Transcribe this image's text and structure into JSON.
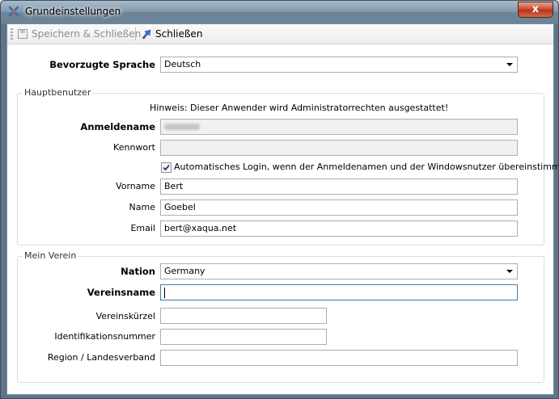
{
  "window": {
    "title": "Grundeinstellungen",
    "close_glyph": "x"
  },
  "toolbar": {
    "save_close": "Speichern & Schließen",
    "close": "Schließen"
  },
  "language": {
    "label": "Bevorzugte Sprache",
    "value": "Deutsch"
  },
  "main_user": {
    "group_title": "Hauptbenutzer",
    "hint": "Hinweis: Dieser Anwender wird Administratorrechten ausgestattet!",
    "login_label": "Anmeldename",
    "password_label": "Kennwort",
    "auto_login_label": "Automatisches Login, wenn der Anmeldenamen und der Windowsnutzer übereinstimmen",
    "auto_login_checked": true,
    "firstname_label": "Vorname",
    "firstname_value": "Bert",
    "lastname_label": "Name",
    "lastname_value": "Goebel",
    "email_label": "Email",
    "email_value": "bert@xaqua.net"
  },
  "club": {
    "group_title": "Mein Verein",
    "nation_label": "Nation",
    "nation_value": "Germany",
    "clubname_label": "Vereinsname",
    "clubname_value": "",
    "short_label": "Vereinskürzel",
    "short_value": "",
    "id_label": "Identifikationsnummer",
    "id_value": "",
    "region_label": "Region / Landesverband",
    "region_value": ""
  }
}
